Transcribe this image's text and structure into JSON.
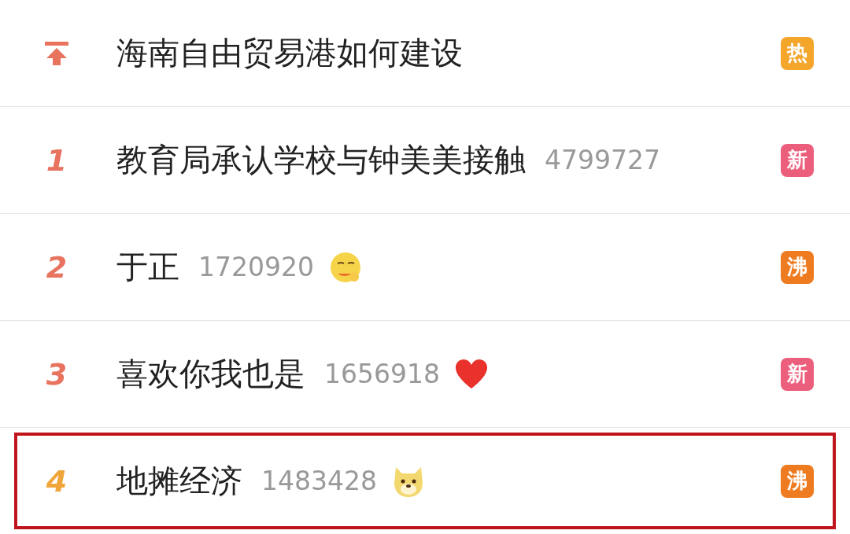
{
  "rows": [
    {
      "kind": "pinned",
      "color": "#e8735f",
      "title": "海南自由贸易港如何建设",
      "badge": {
        "text": "热",
        "color": "#f4a62a"
      },
      "highlighted": false
    },
    {
      "kind": "ranked",
      "rank": "1",
      "color": "#e8735f",
      "title": "教育局承认学校与钟美美接触",
      "count": "4799727",
      "badge": {
        "text": "新",
        "color": "#ec5f7c"
      },
      "highlighted": false
    },
    {
      "kind": "ranked",
      "rank": "2",
      "color": "#e8735f",
      "title": "于正",
      "count": "1720920",
      "emoji": {
        "kind": "smirk"
      },
      "badge": {
        "text": "沸",
        "color": "#ee7b1f"
      },
      "highlighted": false
    },
    {
      "kind": "ranked",
      "rank": "3",
      "color": "#e8735f",
      "title": "喜欢你我也是",
      "count": "1656918",
      "emoji": {
        "kind": "heart"
      },
      "badge": {
        "text": "新",
        "color": "#ec5f7c"
      },
      "highlighted": false
    },
    {
      "kind": "ranked",
      "rank": "4",
      "color": "#f0a53a",
      "title": "地摊经济",
      "count": "1483428",
      "emoji": {
        "kind": "dog"
      },
      "badge": {
        "text": "沸",
        "color": "#ee7b1f"
      },
      "highlighted": true
    }
  ]
}
